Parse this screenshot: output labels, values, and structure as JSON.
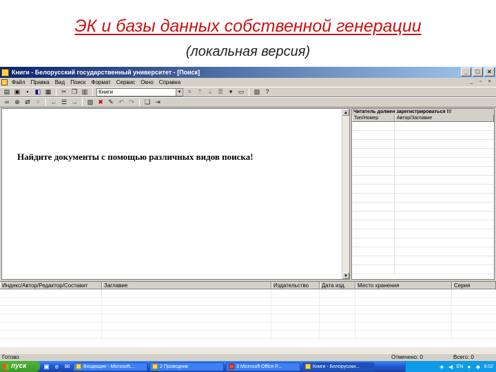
{
  "slide": {
    "title": "ЭК и базы данных собственной генерации",
    "subtitle": "(локальная версия)"
  },
  "window": {
    "title": "Книги - Белорусский государственный университет - [Поиск]",
    "controls": {
      "minimize": "_",
      "maximize": "□",
      "close": "×"
    }
  },
  "menubar": {
    "items": [
      "Файл",
      "Правка",
      "Вид",
      "Поиск",
      "Формат",
      "Сервис",
      "Окно",
      "Справка"
    ],
    "mdi_controls": {
      "minimize": "_",
      "restore": "▫",
      "close": "×"
    }
  },
  "toolbar": {
    "database_select": "Книги",
    "dropdown_arrow": "▼"
  },
  "main": {
    "message": "Найдите документы с помощью различных видов поиска!",
    "scroll_up": "▲",
    "scroll_down": "▼"
  },
  "right_panel": {
    "warning": "Читатель должен зарегистрироваться !!!",
    "columns": [
      "Тип/Номер",
      "Автор/Заглавие"
    ]
  },
  "results": {
    "columns": [
      "Индекс/Автор/Редактор/Составит",
      "Заглавие",
      "Издательство",
      "Дата изд.",
      "Место хранения",
      "Серия"
    ]
  },
  "status": {
    "ready": "Готово",
    "selected": "Отмечено: 0",
    "total": "Всего: 0"
  },
  "taskbar": {
    "start_label": "пуск",
    "tasks": [
      "Входящие - Microsoft...",
      "2 Проводник",
      "3 Microsoft Office P...",
      "Книги - Белорусски..."
    ],
    "language": "EN",
    "clock": "9:02"
  },
  "colors": {
    "title_red": "#cc1111",
    "window_chrome": "#d4d0c8",
    "titlebar_blue": "#0a246a",
    "taskbar_blue": "#245edb",
    "start_green": "#3c9a2b"
  }
}
